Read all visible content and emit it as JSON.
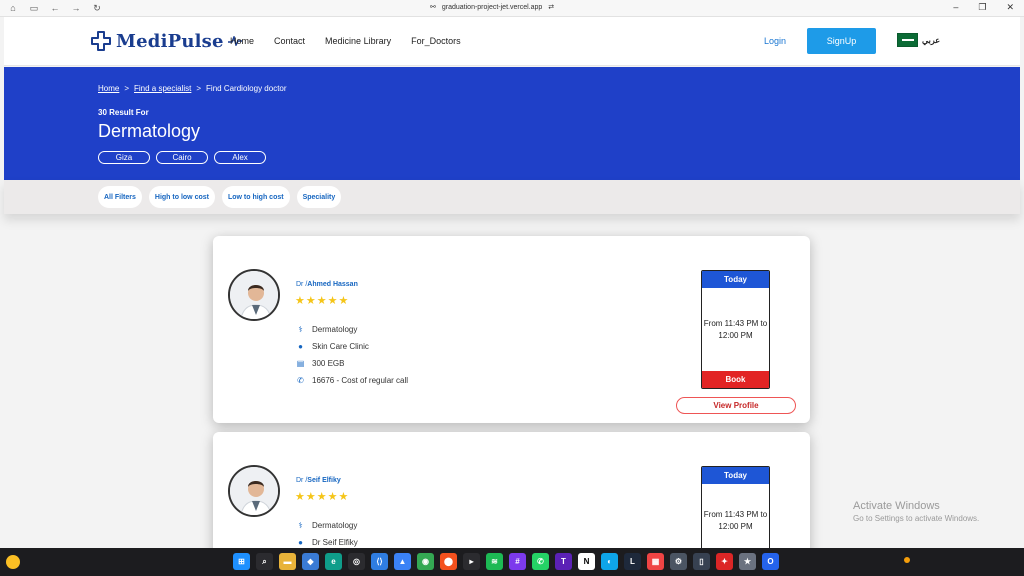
{
  "browser": {
    "url": "graduation-project-jet.vercel.app"
  },
  "header": {
    "logo_text": "MediPulse",
    "nav": [
      "Home",
      "Contact",
      "Medicine Library",
      "For_Doctors"
    ],
    "login_label": "Login",
    "signup_label": "SignUp",
    "language_label": "عربي"
  },
  "hero": {
    "breadcrumb": {
      "home": "Home",
      "sep1": ">",
      "specialist": "Find a specialist",
      "sep2": ">",
      "current": "Find Cardiology doctor"
    },
    "result_count": "30 Result For",
    "title": "Dermatology",
    "locations": [
      "Giza",
      "Cairo",
      "Alex"
    ]
  },
  "filters": [
    "All Filters",
    "High to low cost",
    "Low to high cost",
    "Speciality"
  ],
  "doctors": [
    {
      "prefix": "Dr /",
      "name": "Ahmed Hassan",
      "stars": "★★★★★",
      "specialty": "Dermatology",
      "clinic": "Skin Care Clinic",
      "fee": "300 EGB",
      "phone": "16676 - Cost of regular call",
      "schedule_day": "Today",
      "schedule_time": "From 11:43 PM to 12:00 PM",
      "book_label": "Book",
      "view_profile_label": "View Profile"
    },
    {
      "prefix": "Dr /",
      "name": "Seif Elfiky",
      "stars": "★★★★★",
      "specialty": "Dermatology",
      "clinic": "Dr Seif Elfiky",
      "schedule_day": "Today",
      "schedule_time": "From 11:43 PM to 12:00 PM"
    }
  ],
  "watermark": {
    "line1": "Activate Windows",
    "line2": "Go to Settings to activate Windows."
  },
  "colors": {
    "hero_bg": "#1f40c8",
    "brand": "#1a3d8f",
    "signup_bg": "#1e9be8",
    "book_bg": "#e22424",
    "schedule_header": "#1e56d6"
  }
}
